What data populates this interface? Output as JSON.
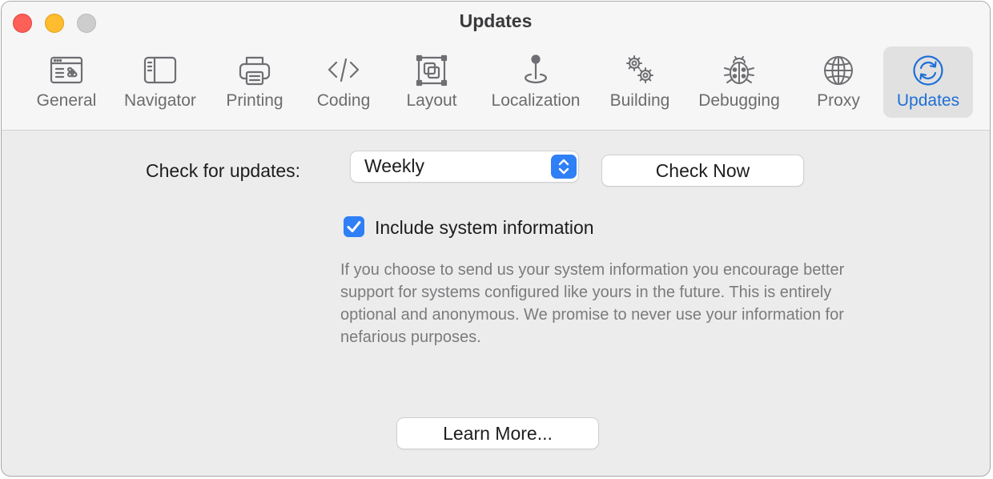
{
  "window": {
    "title": "Updates"
  },
  "toolbar": {
    "items": [
      {
        "label": "General",
        "icon": "general-icon",
        "selected": false
      },
      {
        "label": "Navigator",
        "icon": "sidebar-icon",
        "selected": false
      },
      {
        "label": "Printing",
        "icon": "printer-icon",
        "selected": false
      },
      {
        "label": "Coding",
        "icon": "code-brackets-icon",
        "selected": false
      },
      {
        "label": "Layout",
        "icon": "layout-icon",
        "selected": false
      },
      {
        "label": "Localization",
        "icon": "location-pin-icon",
        "selected": false
      },
      {
        "label": "Building",
        "icon": "gears-icon",
        "selected": false
      },
      {
        "label": "Debugging",
        "icon": "ladybug-icon",
        "selected": false
      },
      {
        "label": "Proxy",
        "icon": "globe-icon",
        "selected": false
      },
      {
        "label": "Updates",
        "icon": "refresh-icon",
        "selected": true
      }
    ]
  },
  "updates": {
    "check_label": "Check for updates:",
    "frequency": {
      "selected": "Weekly"
    },
    "check_now_label": "Check Now",
    "include_system_info": {
      "label": "Include system information",
      "checked": true
    },
    "help_text": "If you choose to send us your system information you encourage better support for systems configured like yours in the future. This is entirely optional and anonymous. We promise to never use your information for nefarious purposes.",
    "learn_more_label": "Learn More..."
  },
  "colors": {
    "accent": "#2f7ff6",
    "selected_text": "#1f6fd6",
    "close": "#fe5f57",
    "minimize": "#febc2e",
    "zoom_inactive": "#cdcdcd"
  }
}
